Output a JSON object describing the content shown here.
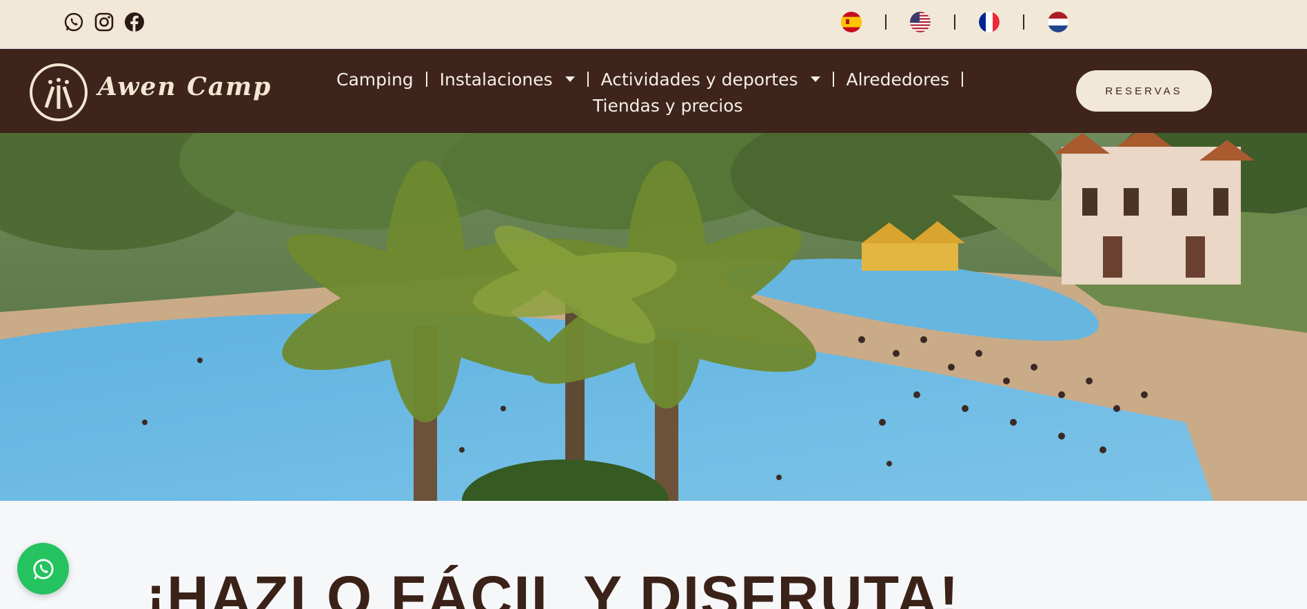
{
  "topbar": {
    "social": [
      {
        "icon": "whatsapp-icon"
      },
      {
        "icon": "instagram-icon"
      },
      {
        "icon": "facebook-icon"
      }
    ],
    "languages": [
      {
        "code": "es",
        "icon": "spain-flag-icon"
      },
      {
        "code": "en",
        "icon": "usa-flag-icon"
      },
      {
        "code": "fr",
        "icon": "france-flag-icon"
      },
      {
        "code": "nl",
        "icon": "netherlands-flag-icon"
      }
    ]
  },
  "nav": {
    "brand": "Awen Camp",
    "items": [
      {
        "label": "Camping"
      },
      {
        "label": "Instalaciones"
      },
      {
        "label": "Actividades y deportes"
      },
      {
        "label": "Alrededores"
      },
      {
        "label": "Tiendas y precios"
      }
    ],
    "cta": "RESERVAS"
  },
  "main": {
    "headline": "¡HAZLO FÁCIL Y DISFRUTA!"
  },
  "colors": {
    "brown": "#3e241b",
    "cream": "#f1e8d7",
    "whatsapp_green": "#25c260"
  }
}
